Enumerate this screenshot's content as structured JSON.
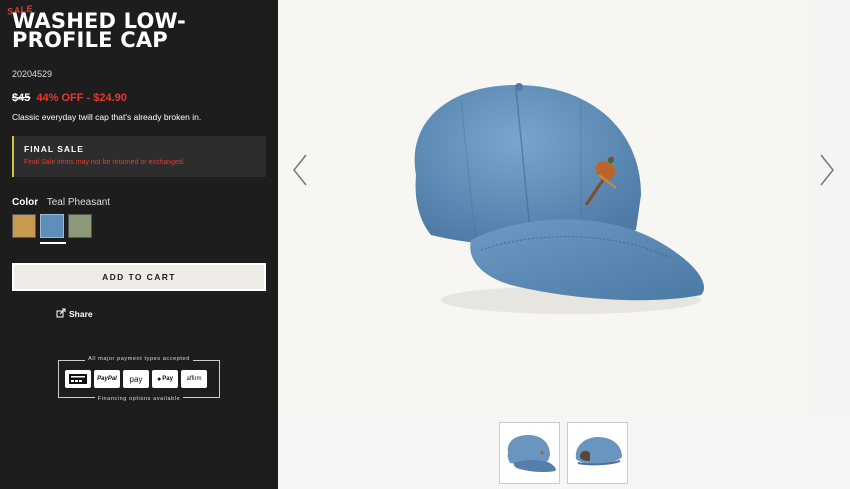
{
  "product": {
    "sale_tag": "SALE",
    "title": "WASHED LOW-PROFILE CAP",
    "sku": "20204529",
    "original_price": "$45",
    "discount_text": "44% OFF - $24.90",
    "description": "Classic everyday twill cap that's already broken in."
  },
  "final_sale": {
    "heading": "FINAL SALE",
    "text": "Final Sale items may not be returned or exchanged."
  },
  "color": {
    "label": "Color",
    "selected": "Teal Pheasant",
    "swatches": [
      {
        "name": "tan",
        "color": "#c89a4e"
      },
      {
        "name": "teal-pheasant",
        "color": "#5f8fb8"
      },
      {
        "name": "olive",
        "color": "#8a9a78"
      }
    ]
  },
  "actions": {
    "add_to_cart": "ADD TO CART",
    "share": "Share"
  },
  "payment": {
    "top_text": "All major payment types accepted",
    "bottom_text": "Financing options available",
    "methods": [
      "card",
      "PayPal",
      "pay",
      "Pay",
      "affirm"
    ]
  },
  "colors": {
    "sidebar_bg": "#1d1d1d",
    "sale_red": "#e8382d",
    "cap_blue": "#5f8fb8"
  }
}
